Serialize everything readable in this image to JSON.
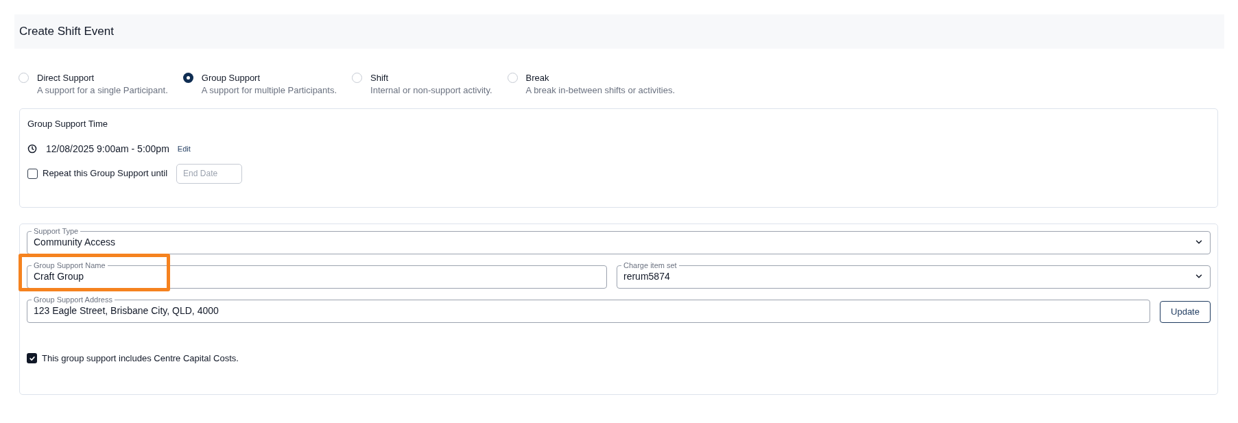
{
  "header": {
    "title": "Create Shift Event"
  },
  "event_types": [
    {
      "label": "Direct Support",
      "description": "A support for a single Participant.",
      "selected": false
    },
    {
      "label": "Group Support",
      "description": "A support for multiple Participants.",
      "selected": true
    },
    {
      "label": "Shift",
      "description": "Internal or non-support activity.",
      "selected": false
    },
    {
      "label": "Break",
      "description": "A break in-between shifts or activities.",
      "selected": false
    }
  ],
  "time_card": {
    "title": "Group Support Time",
    "datetime": "12/08/2025 9:00am - 5:00pm",
    "edit": "Edit",
    "repeat": {
      "label": "Repeat this Group Support until",
      "checked": false
    },
    "end_date": {
      "placeholder": "End Date"
    }
  },
  "details": {
    "support_type": {
      "label": "Support Type",
      "value": "Community Access"
    },
    "group_name": {
      "label": "Group Support Name",
      "value": "Craft Group",
      "highlighted": true
    },
    "charge_item_set": {
      "label": "Charge item set",
      "value": "rerum5874"
    },
    "address": {
      "label": "Group Support Address",
      "value": "123 Eagle Street, Brisbane City, QLD, 4000"
    },
    "update_button": "Update",
    "capital_costs": {
      "label": "This group support includes Centre Capital Costs.",
      "checked": true
    }
  }
}
